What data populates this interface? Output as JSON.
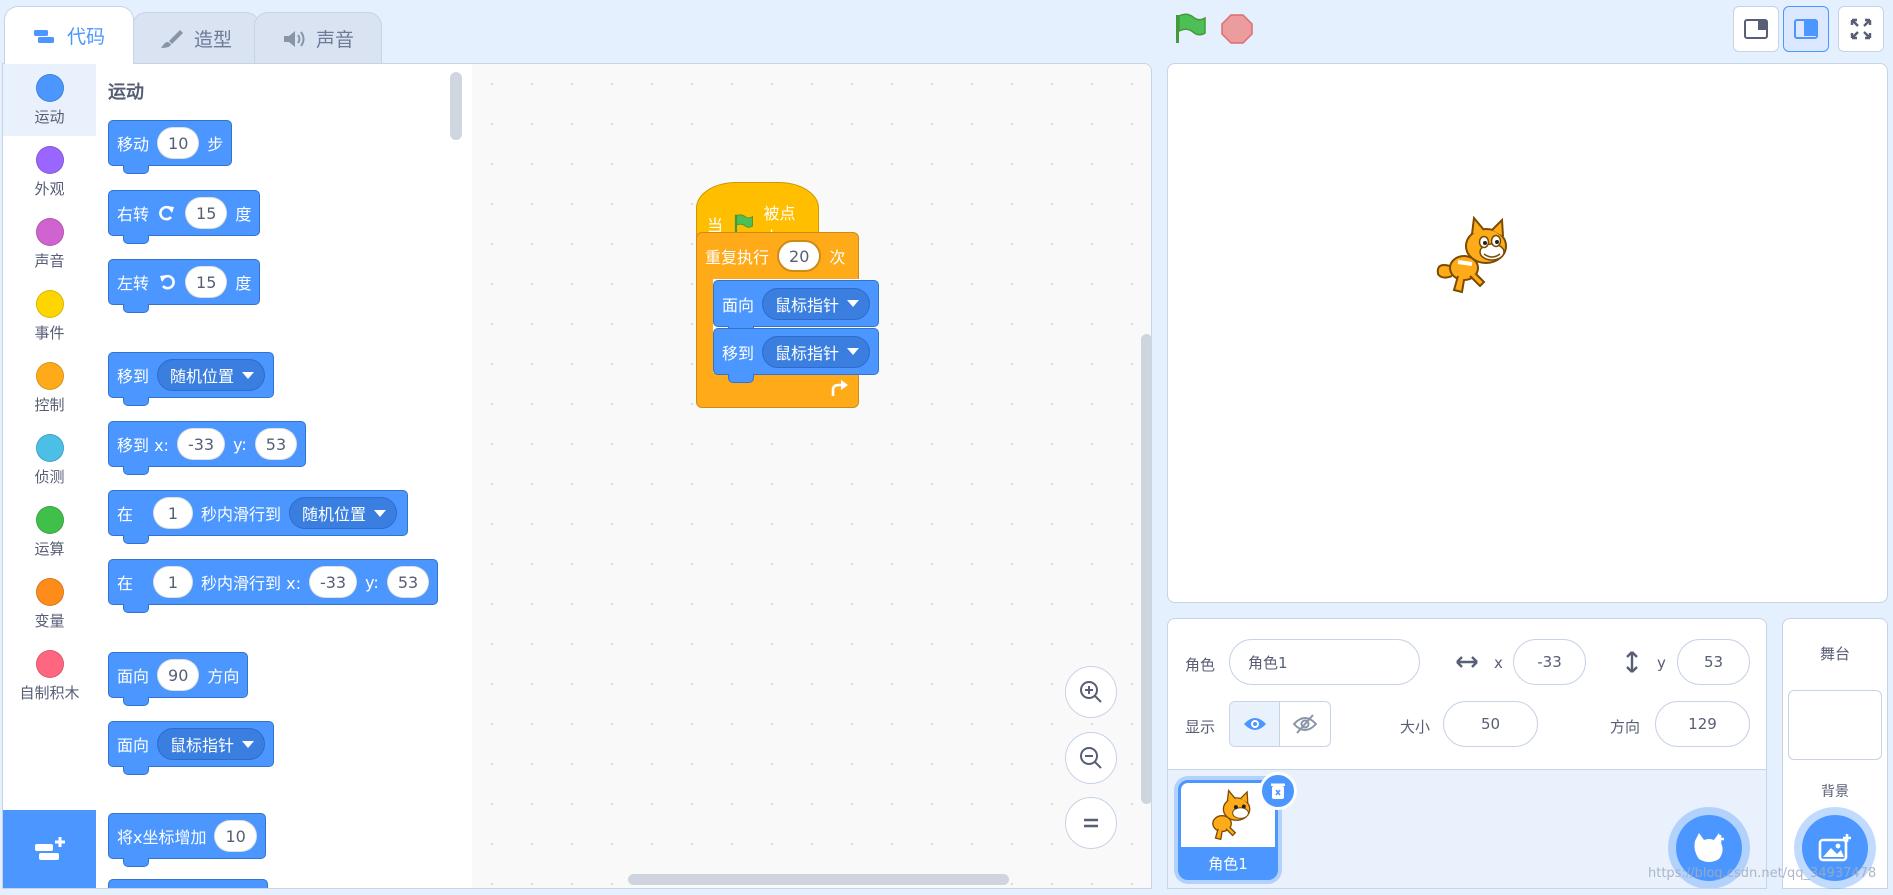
{
  "tabs": [
    {
      "label": "代码",
      "icon": "code-icon"
    },
    {
      "label": "造型",
      "icon": "brush-icon"
    },
    {
      "label": "声音",
      "icon": "speaker-icon"
    }
  ],
  "header": {
    "green_flag": "green-flag-icon",
    "stop": "stop-icon"
  },
  "categories": [
    {
      "label": "运动",
      "color": "#4c97ff"
    },
    {
      "label": "外观",
      "color": "#9966ff"
    },
    {
      "label": "声音",
      "color": "#cf63cf"
    },
    {
      "label": "事件",
      "color": "#ffd500"
    },
    {
      "label": "控制",
      "color": "#ffab19"
    },
    {
      "label": "侦测",
      "color": "#4cbfe6"
    },
    {
      "label": "运算",
      "color": "#40bf4a"
    },
    {
      "label": "变量",
      "color": "#ff8c1a"
    },
    {
      "label": "自制积木",
      "color": "#ff6680"
    }
  ],
  "palette": {
    "title": "运动",
    "move": {
      "pre": "移动",
      "val": "10",
      "post": "步"
    },
    "turn_right": {
      "pre": "右转",
      "val": "15",
      "post": "度"
    },
    "turn_left": {
      "pre": "左转",
      "val": "15",
      "post": "度"
    },
    "goto": {
      "pre": "移到",
      "drop": "随机位置"
    },
    "goto_xy": {
      "pre": "移到 x:",
      "x": "-33",
      "ylabel": "y:",
      "y": "53"
    },
    "glide": {
      "pre": "在",
      "val": "1",
      "mid": "秒内滑行到",
      "drop": "随机位置"
    },
    "glide_xy": {
      "pre": "在",
      "val": "1",
      "mid": "秒内滑行到 x:",
      "x": "-33",
      "ylabel": "y:",
      "y": "53"
    },
    "point_dir": {
      "pre": "面向",
      "val": "90",
      "post": "方向"
    },
    "point_towards": {
      "pre": "面向",
      "drop": "鼠标指针"
    },
    "change_x": {
      "pre": "将x坐标增加",
      "val": "10"
    }
  },
  "script": {
    "hat": {
      "pre": "当",
      "post": "被点击"
    },
    "repeat": {
      "pre": "重复执行",
      "val": "20",
      "post": "次"
    },
    "inner1": {
      "pre": "面向",
      "drop": "鼠标指针"
    },
    "inner2": {
      "pre": "移到",
      "drop": "鼠标指针"
    }
  },
  "sprite_info": {
    "sprite_label": "角色",
    "sprite_name": "角色1",
    "x_label": "x",
    "x": "-33",
    "y_label": "y",
    "y": "53",
    "show_label": "显示",
    "size_label": "大小",
    "size": "50",
    "direction_label": "方向",
    "direction": "129"
  },
  "sprite_list": [
    {
      "name": "角色1",
      "selected": true
    }
  ],
  "stage_pane": {
    "title": "舞台",
    "backdrop_label": "背景"
  },
  "watermark": "https://blog.csdn.net/qq_34937478"
}
